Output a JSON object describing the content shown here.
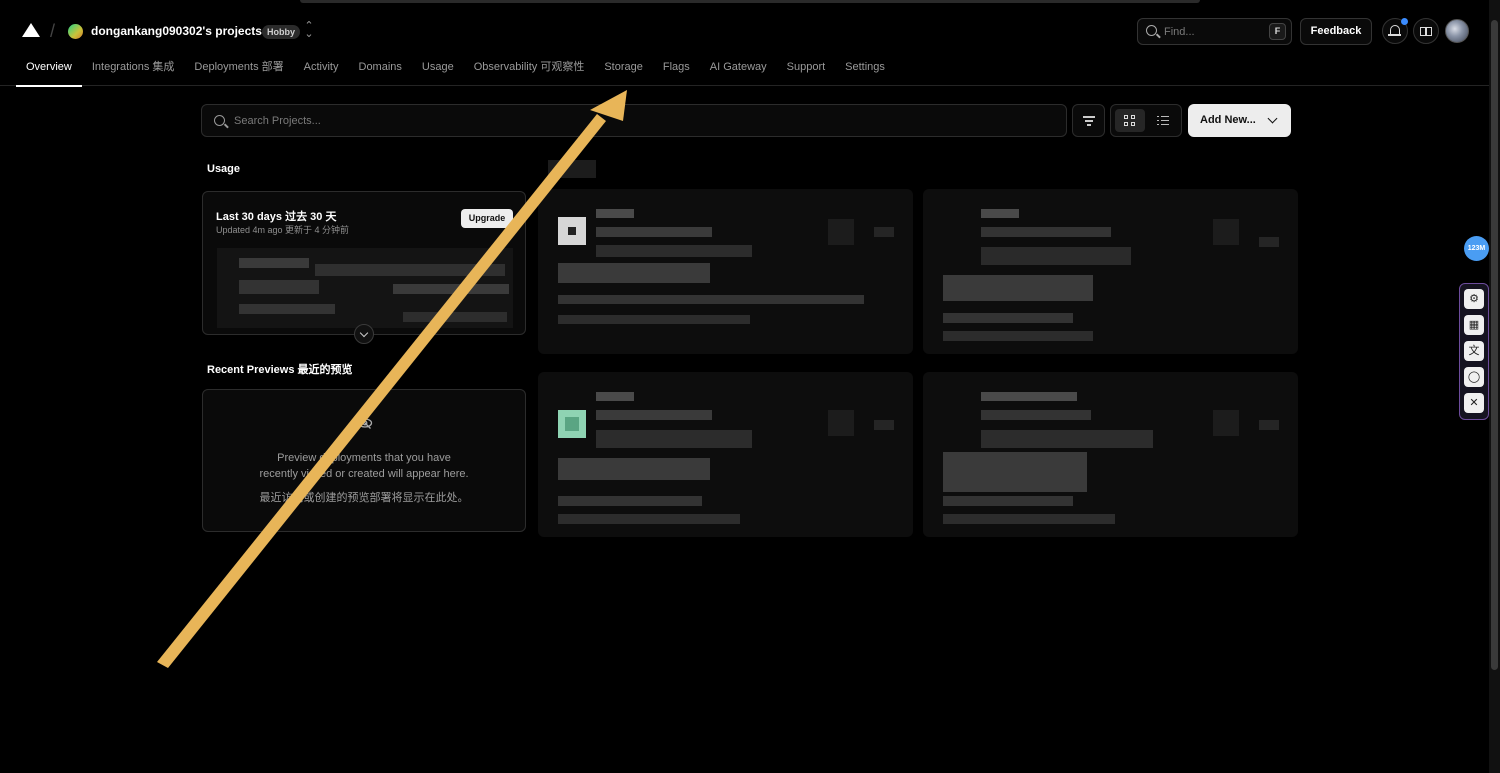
{
  "header": {
    "team_name": "dongankang090302's projects",
    "plan_badge": "Hobby",
    "find_placeholder": "Find...",
    "find_shortcut": "F",
    "feedback_label": "Feedback"
  },
  "tabs": [
    {
      "label": "Overview",
      "active": true
    },
    {
      "label": "Integrations 集成",
      "active": false
    },
    {
      "label": "Deployments 部署",
      "active": false
    },
    {
      "label": "Activity",
      "active": false
    },
    {
      "label": "Domains",
      "active": false
    },
    {
      "label": "Usage",
      "active": false
    },
    {
      "label": "Observability 可观察性",
      "active": false
    },
    {
      "label": "Storage",
      "active": false
    },
    {
      "label": "Flags",
      "active": false
    },
    {
      "label": "AI Gateway",
      "active": false
    },
    {
      "label": "Support",
      "active": false
    },
    {
      "label": "Settings",
      "active": false
    }
  ],
  "toolbar": {
    "search_placeholder": "Search Projects...",
    "add_new_label": "Add New..."
  },
  "usage": {
    "section_title": "Usage",
    "card_title": "Last 30 days 过去 30 天",
    "updated": "Updated 4m ago 更新于 4 分钟前",
    "upgrade_label": "Upgrade"
  },
  "previews": {
    "section_title": "Recent Previews 最近的预览",
    "empty_line1": "Preview deployments that you have",
    "empty_line2": "recently visited or created will appear here.",
    "empty_line_zh": "最近访问或创建的预览部署将显示在此处。"
  },
  "extension": {
    "badge": "123M"
  },
  "colors": {
    "background": "#000000",
    "annotation_arrow": "#e8b558",
    "notification_dot": "#3b8cff"
  }
}
